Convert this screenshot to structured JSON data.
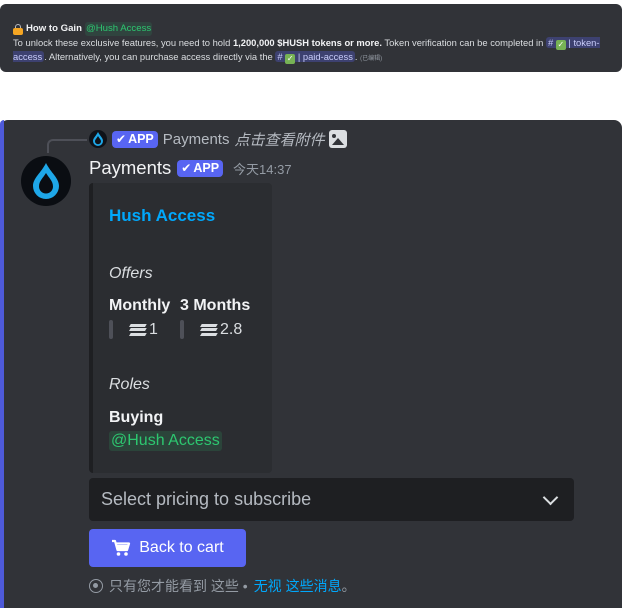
{
  "snippet": {
    "title": "How to Gain",
    "role": "@Hush Access",
    "line1_a": "To unlock these exclusive features, you need to hold",
    "line1_bold": "1,200,000 $HUSH tokens or more.",
    "line1_b": "Token verification can be completed in",
    "channel1_name": "token-access",
    "line2_a": ". Alternatively, you can purchase access directly via the",
    "channel2_name": "paid-access",
    "line2_b": ".",
    "edited": "(已编辑)",
    "hash": "#",
    "check": "✓",
    "sep": "|"
  },
  "reply": {
    "app_tag": "APP",
    "author": "Payments",
    "text": "点击查看附件"
  },
  "message": {
    "username": "Payments",
    "app_tag": "APP",
    "timestamp": "今天14:37"
  },
  "embed": {
    "title": "Hush Access",
    "offers_label": "Offers",
    "fields": [
      {
        "name": "Monthly",
        "value": "1"
      },
      {
        "name": "3 Months",
        "value": "2.8"
      }
    ],
    "roles_label": "Roles",
    "buying_label": "Buying",
    "buying_role": "@Hush Access"
  },
  "select": {
    "placeholder": "Select pricing to subscribe"
  },
  "button": {
    "label": "Back to cart"
  },
  "ephemeral": {
    "prefix": "只有您才能看到 这些 •",
    "dismiss": "无视",
    "rest": "这些消息",
    "end": "。"
  },
  "colors": {
    "accent": "#5865f2",
    "link": "#00a8fc",
    "role": "#2dc770",
    "bg": "#313338"
  }
}
